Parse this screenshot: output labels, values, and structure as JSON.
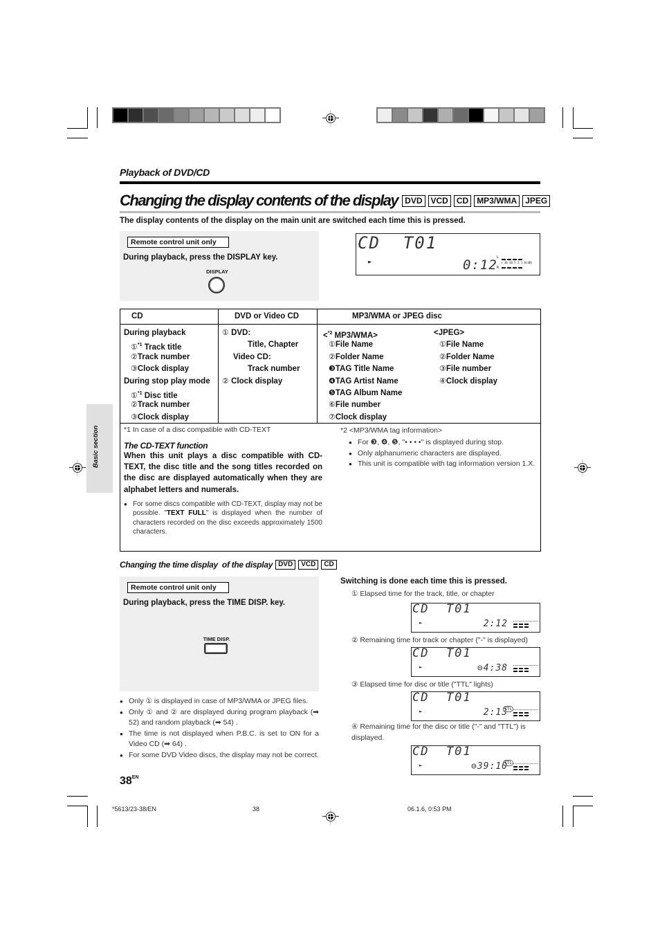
{
  "section_label": "Playback of DVD/CD",
  "title": {
    "text": "Changing the display contents of the display",
    "badges": [
      "DVD",
      "VCD",
      "CD",
      "MP3/WMA",
      "JPEG"
    ]
  },
  "intro": "The display contents of the display on the main unit are switched each time this is pressed.",
  "display_key_box": {
    "tag": "Remote control unit only",
    "instruction": "During playback, press the DISPLAY key.",
    "key_label": "DISPLAY"
  },
  "main_lcd": {
    "line1": "CD  T01",
    "play": "►",
    "time": "0:12",
    "meter_left": "L",
    "meter_right": "R",
    "meter_scale": "∞ 30 10 5 3 1 0(dB)"
  },
  "table": {
    "headers": [
      "CD",
      "DVD or Video CD",
      "MP3/WMA or JPEG disc"
    ],
    "cd": [
      {
        "text": "During playback",
        "marker": "",
        "indent": false
      },
      {
        "text": "Track title",
        "marker": "①",
        "sup": "*1",
        "indent": true
      },
      {
        "text": "Track number",
        "marker": "②",
        "indent": true
      },
      {
        "text": "Clock display",
        "marker": "③",
        "indent": true
      },
      {
        "text": "During stop play mode",
        "marker": "",
        "indent": false
      },
      {
        "text": "Disc title",
        "marker": "①",
        "sup": "*1",
        "indent": true
      },
      {
        "text": "Track number",
        "marker": "②",
        "indent": true
      },
      {
        "text": "Clock display",
        "marker": "③",
        "indent": true
      }
    ],
    "dvd": [
      {
        "text": "DVD:",
        "marker": "①"
      },
      {
        "text": "Title, Chapter",
        "marker": ""
      },
      {
        "text": "Video CD:",
        "marker": ""
      },
      {
        "text": "Track number",
        "marker": ""
      },
      {
        "text": "Clock display",
        "marker": "②"
      }
    ],
    "mp3_header": "MP3/WMA>",
    "mp3_header_sup": "*2",
    "mp3": [
      {
        "text": "File Name",
        "marker": "①"
      },
      {
        "text": "Folder Name",
        "marker": "②"
      },
      {
        "text": "TAG Title Name",
        "marker": "❸"
      },
      {
        "text": "TAG Artist Name",
        "marker": "❹"
      },
      {
        "text": "TAG Album Name",
        "marker": "❺"
      },
      {
        "text": "File number",
        "marker": "⑥"
      },
      {
        "text": "Clock display",
        "marker": "⑦"
      }
    ],
    "jpeg_header": "<JPEG>",
    "jpeg": [
      {
        "text": "File Name",
        "marker": "①"
      },
      {
        "text": "Folder Name",
        "marker": "②"
      },
      {
        "text": "File number",
        "marker": "③"
      },
      {
        "text": "Clock display",
        "marker": "④"
      }
    ],
    "note1": "*1 In case of a disc compatible with CD-TEXT",
    "cdtext_title": "The CD-TEXT function",
    "cdtext_body": "When this unit plays a disc compatible with CD-TEXT, the disc title and the song titles recorded on the disc are displayed automatically when they are alphabet letters and numerals.",
    "cdtext_bullet_pre": "For some discs compatible with CD-TEXT, display may not be possible. \"",
    "cdtext_bullet_bold": "TEXT FULL",
    "cdtext_bullet_post": "\" is displayed when the number of characters recorded on the disc exceeds approximately 1500 characters.",
    "note2": "*2 <MP3/WMA tag information>",
    "note2_bullets": [
      "For ❸, ❹, ❺, \"• • • •\" is displayed during stop.",
      "Only alphanumeric characters are displayed.",
      "This unit is compatible with tag information version 1.X."
    ]
  },
  "side_tab": "Basic section",
  "time_section": {
    "title": "Changing the time display  of the display",
    "badges": [
      "DVD",
      "VCD",
      "CD"
    ],
    "tag": "Remote control unit only",
    "instruction": "During playback, press the TIME DISP. key.",
    "key_label": "TIME DISP.",
    "bullets": [
      "Only ① is displayed in case of MP3/WMA or JPEG files.",
      "Only ① and ② are displayed during program playback (➡ 52) and random playback (➡ 54) .",
      "The time is not displayed when P.B.C. is set to ON for a Video CD (➡ 64) .",
      "For some DVD Video discs, the display may not be correct."
    ],
    "switch_heading": "Switching is done each time this is pressed.",
    "steps": [
      {
        "label": "① Elapsed time for the track, title, or chapter",
        "lcd_line1": "CD  T01",
        "time": "2:12",
        "ttl": false
      },
      {
        "label": "② Remaining time for track or chapter (\"-\" is displayed)",
        "lcd_line1": "CD  T01",
        "time": "⊖4:38",
        "ttl": false
      },
      {
        "label": "③ Elapsed time for disc or title (\"TTL\" lights)",
        "lcd_line1": "CD  T01",
        "time": "2:13",
        "ttl": true
      },
      {
        "label": "④ Remaining time for the disc or title (\"-\" and \"TTL\") is displayed.",
        "lcd_line1": "CD  T01",
        "time": "⊖39:10",
        "ttl": true
      }
    ],
    "ttl_label": "TTL"
  },
  "page_number": "38",
  "page_suffix": "EN",
  "footer": {
    "code": "*5613/23-38/EN",
    "page": "38",
    "timestamp": "06.1.6, 0:53 PM"
  },
  "color_bars": {
    "left": [
      "#000000",
      "#2e2e2e",
      "#4f4f4f",
      "#6b6b6b",
      "#878787",
      "#a0a0a0",
      "#b6b6b6",
      "#cacaca",
      "#dddddd",
      "#eeeeee",
      "#ffffff"
    ],
    "right": [
      "#eeeeee",
      "#8a8a8a",
      "#c6c6c6",
      "#333333",
      "#aeaeae",
      "#6b6b6b",
      "#000000",
      "#f6f6f6",
      "#c6c6c6",
      "#e4e4e4",
      "#a0a0a0"
    ]
  }
}
